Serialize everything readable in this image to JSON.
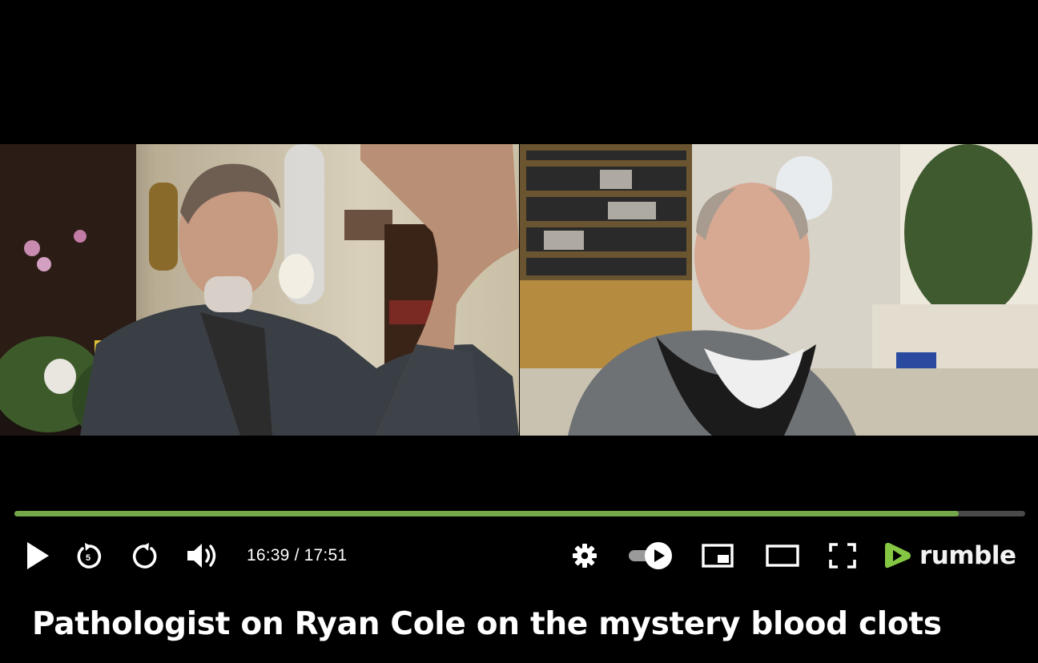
{
  "video": {
    "progress": 0.934,
    "current_time": "16:39",
    "separator": " / ",
    "duration": "17:51",
    "accent_color": "#74a64a"
  },
  "controls": {
    "icons": [
      "play-icon",
      "replay-icon",
      "forward-icon",
      "volume-icon",
      "gear-icon",
      "autoplay-toggle-icon",
      "miniplayer-icon",
      "theater-mode-icon",
      "fullscreen-icon"
    ],
    "autoplay_on": true
  },
  "brand": {
    "logo_text": "rumble",
    "logo_color": "#85c742"
  },
  "title": {
    "text": "Pathologist on Ryan Cole on the mystery blood clots"
  }
}
